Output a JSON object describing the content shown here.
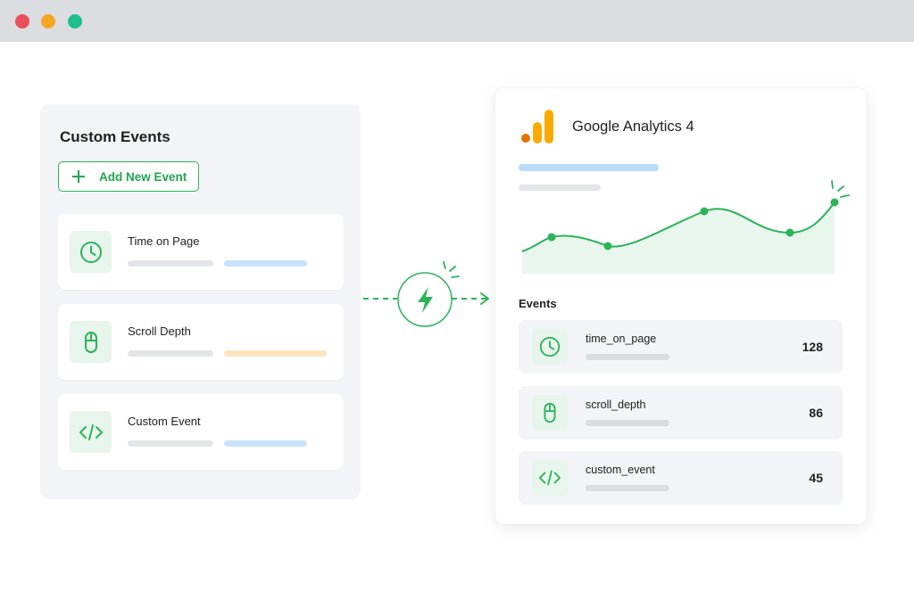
{
  "window": {
    "controls": [
      {
        "name": "close",
        "color": "#ec4d5b"
      },
      {
        "name": "minimize",
        "color": "#f5a623"
      },
      {
        "name": "maximize",
        "color": "#1fbf8a"
      }
    ]
  },
  "custom_events": {
    "title": "Custom Events",
    "add_button_label": "Add New Event",
    "items": [
      {
        "name": "Time on Page",
        "icon": "clock-icon",
        "accent": "#c8e3fb"
      },
      {
        "name": "Scroll Depth",
        "icon": "mouse-icon",
        "accent": "#fde3bf"
      },
      {
        "name": "Custom Event",
        "icon": "code-icon",
        "accent": "#c8e3fb"
      }
    ]
  },
  "connector": {
    "icon": "lightning-icon",
    "color": "#2bb35a"
  },
  "analytics": {
    "title": "Google Analytics 4",
    "logo_colors": [
      "#f9ab00",
      "#e37400"
    ],
    "events_label": "Events",
    "events": [
      {
        "name": "time_on_page",
        "count": "128",
        "icon": "clock-icon"
      },
      {
        "name": "scroll_depth",
        "count": "86",
        "icon": "mouse-icon"
      },
      {
        "name": "custom_event",
        "count": "45",
        "icon": "code-icon"
      }
    ]
  },
  "colors": {
    "accent_green": "#2bb35a",
    "area_fill": "#e9f6ee"
  }
}
